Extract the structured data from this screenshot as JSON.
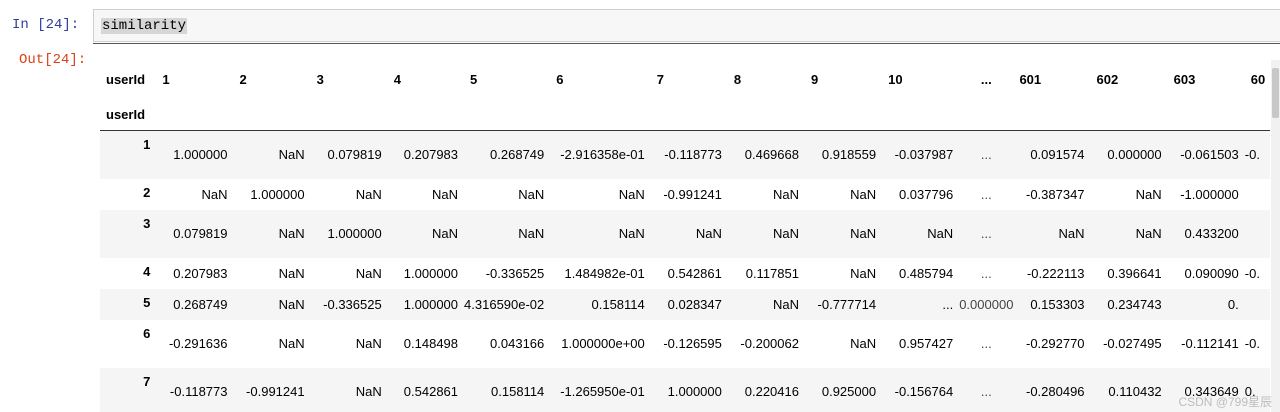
{
  "input_prompt": "In  [24]:",
  "output_prompt": "Out[24]:",
  "code": "similarity",
  "table": {
    "index_label": "userId",
    "columns_label": "userId",
    "columns": [
      "1",
      "2",
      "3",
      "4",
      "5",
      "6",
      "7",
      "8",
      "9",
      "10",
      "...",
      "601",
      "602",
      "603",
      "60"
    ],
    "rows": [
      {
        "label": "1",
        "cells": [
          "1.000000",
          "NaN",
          "0.079819",
          "0.207983",
          "0.268749",
          "-2.916358e-01",
          "-0.118773",
          "0.469668",
          "0.918559",
          "-0.037987",
          "...",
          "0.091574",
          "0.000000",
          "-0.061503",
          "-0."
        ]
      },
      {
        "label": "2",
        "cells": [
          "NaN",
          "1.000000",
          "NaN",
          "NaN",
          "NaN",
          "NaN",
          "-0.991241",
          "NaN",
          "NaN",
          "0.037796",
          "...",
          "-0.387347",
          "NaN",
          "-1.000000",
          ""
        ]
      },
      {
        "label": "3",
        "cells": [
          "0.079819",
          "NaN",
          "1.000000",
          "NaN",
          "NaN",
          "NaN",
          "NaN",
          "NaN",
          "NaN",
          "NaN",
          "...",
          "NaN",
          "NaN",
          "0.433200",
          ""
        ]
      },
      {
        "label": "4",
        "cells": [
          "0.207983",
          "NaN",
          "NaN",
          "1.000000",
          "-0.336525",
          "1.484982e-01",
          "0.542861",
          "0.117851",
          "NaN",
          "0.485794",
          "...",
          "-0.222113",
          "0.396641",
          "0.090090",
          "-0."
        ]
      },
      {
        "label": "5",
        "cells": [
          "0.268749",
          "NaN",
          "-0.336525",
          "1.000000",
          "4.316590e-02",
          "0.158114",
          "0.028347",
          "NaN",
          "-0.777714",
          "...",
          "0.000000",
          "0.153303",
          "0.234743",
          "0."
        ]
      },
      {
        "label": "6",
        "cells": [
          "-0.291636",
          "NaN",
          "NaN",
          "0.148498",
          "0.043166",
          "1.000000e+00",
          "-0.126595",
          "-0.200062",
          "NaN",
          "0.957427",
          "...",
          "-0.292770",
          "-0.027495",
          "-0.112141",
          "-0."
        ]
      },
      {
        "label": "7",
        "cells": [
          "-0.118773",
          "-0.991241",
          "NaN",
          "0.542861",
          "0.158114",
          "-1.265950e-01",
          "1.000000",
          "0.220416",
          "0.925000",
          "-0.156764",
          "...",
          "-0.280496",
          "0.110432",
          "0.343649",
          "0."
        ]
      }
    ]
  },
  "watermark": "CSDN @799星辰"
}
